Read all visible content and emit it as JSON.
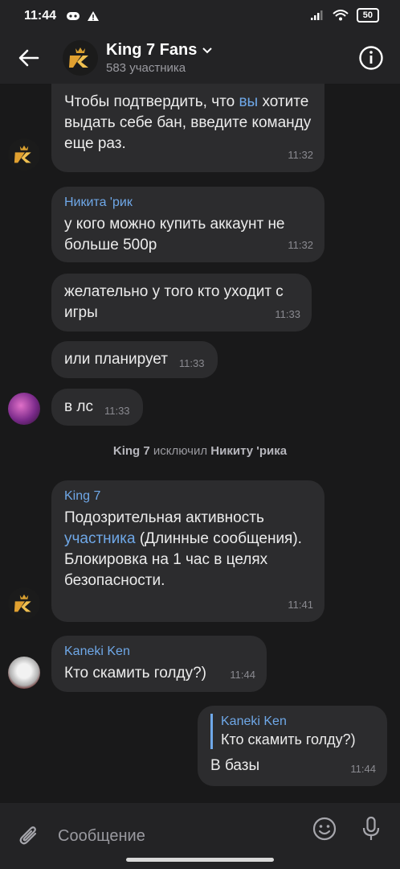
{
  "status": {
    "time": "11:44",
    "battery": "50"
  },
  "header": {
    "title": "King 7 Fans",
    "subtitle": "583 участника"
  },
  "messages": [
    {
      "lines": [
        "Чтобы подтвердить, что ",
        "вы",
        " хотите выдать себе бан, введите команду еще раз."
      ],
      "time": "11:32"
    },
    {
      "sender": "Никита 'рик",
      "text": "у кого можно купить аккаунт не больше 500р",
      "time": "11:32"
    },
    {
      "text": "желательно у того кто уходит с игры",
      "time": "11:33"
    },
    {
      "text": "или планирует",
      "time": "11:33"
    },
    {
      "text": "в лс",
      "time": "11:33"
    },
    {
      "sender": "King 7",
      "text_a": "Подозрительная активность ",
      "link": "участника",
      "text_b": " (Длинные сообщения).",
      "text_c": "Блокировка на 1 час в целях безопасности.",
      "time": "11:41"
    },
    {
      "sender": "Kaneki Ken",
      "text": "Кто скамить голду?)",
      "time": "11:44"
    },
    {
      "reply_name": "Kaneki Ken",
      "reply_text": "Кто скамить голду?)",
      "text": "В базы",
      "time": "11:44"
    }
  ],
  "service": {
    "actor": "King 7",
    "action": " исключил ",
    "target": "Никиту 'рика"
  },
  "composer": {
    "placeholder": "Сообщение"
  },
  "icons": {
    "back": "arrow-left",
    "info": "info-circle",
    "attach": "paperclip",
    "emoji": "smiley",
    "mic": "microphone"
  }
}
